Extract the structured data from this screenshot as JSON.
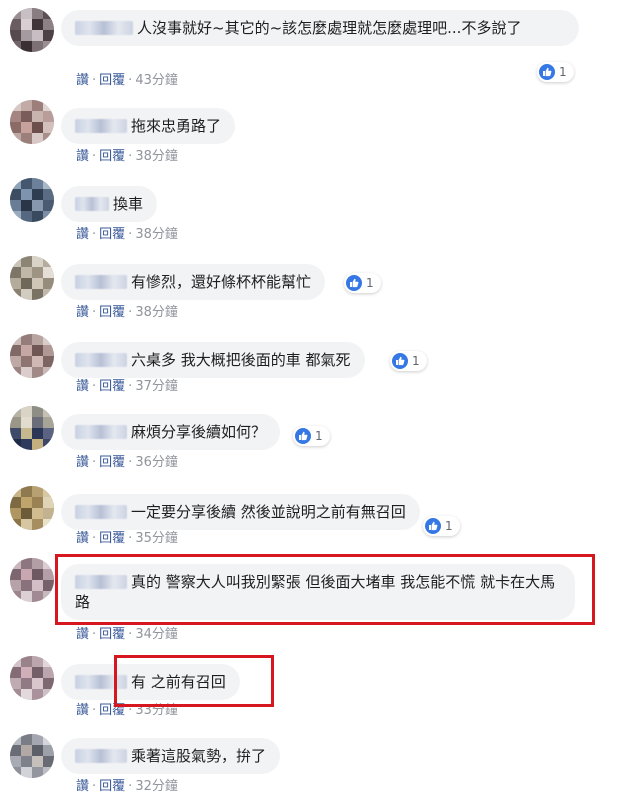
{
  "actions": {
    "like": "讚",
    "reply": "回覆",
    "dot": "·"
  },
  "comments": [
    {
      "text": "人沒事就好~其它的~該怎麼處理就怎麼處理吧...不多說了",
      "time": "43分鐘",
      "likes": "1"
    },
    {
      "text": "拖來忠勇路了",
      "time": "38分鐘"
    },
    {
      "text": "換車",
      "time": "38分鐘"
    },
    {
      "text": "有慘烈，還好條杯杯能幫忙",
      "time": "38分鐘",
      "likes": "1"
    },
    {
      "text": "六桌多 我大概把後面的車 都氣死",
      "time": "37分鐘",
      "likes": "1"
    },
    {
      "text": "麻煩分享後續如何？",
      "time": "36分鐘",
      "likes": "1"
    },
    {
      "text": "一定要分享後續 然後並說明之前有無召回",
      "time": "35分鐘",
      "likes": "1"
    },
    {
      "text": "真的 警察大人叫我別緊張 但後面大堵車 我怎能不慌 就卡在大馬路",
      "time": "34分鐘"
    },
    {
      "text": "有 之前有召回",
      "time": "33分鐘"
    },
    {
      "text": "乘著這股氣勢，拚了",
      "time": "32分鐘"
    }
  ],
  "colors": {
    "like_blue": "#3578e5",
    "link_blue": "#385898",
    "highlight_red": "#d6171f",
    "bubble_bg": "#f2f3f5"
  },
  "icons": {
    "like": "thumbs-up-icon"
  }
}
